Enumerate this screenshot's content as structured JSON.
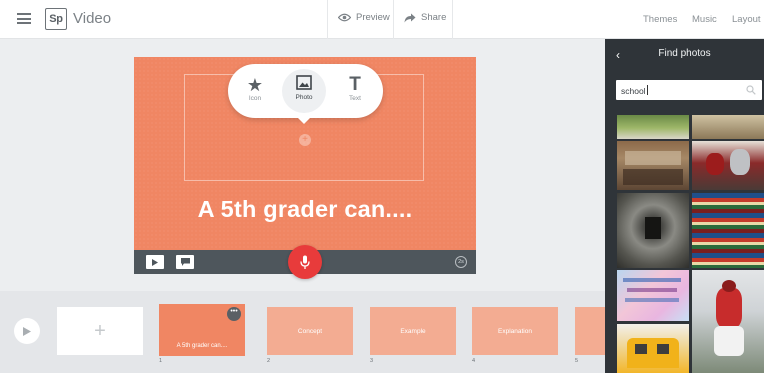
{
  "topbar": {
    "logo": "Sp",
    "app_name": "Video",
    "preview": "Preview",
    "share": "Share",
    "themes": "Themes",
    "music": "Music",
    "layout": "Layout"
  },
  "slide": {
    "title": "A 5th grader can....",
    "add_menu": {
      "icon": "Icon",
      "photo": "Photo",
      "text": "Text",
      "selected": "Photo"
    },
    "timer_badge": "2s"
  },
  "filmstrip": {
    "add_symbol": "+",
    "thumbs": [
      {
        "label": "A 5th grader can....",
        "number": "1",
        "active": true
      },
      {
        "label": "Concept",
        "number": "2"
      },
      {
        "label": "Example",
        "number": "3"
      },
      {
        "label": "Explanation",
        "number": "4"
      },
      {
        "label": "",
        "number": "5"
      }
    ]
  },
  "panel": {
    "title": "Find photos",
    "search_value": "school",
    "photo_results": [
      "field-photo",
      "sky-photo",
      "classroom-photo",
      "football-photo",
      "hallway-photo",
      "books-photo",
      "poster-photo",
      "baseball-photo",
      "bus-photo",
      "player-photo"
    ]
  },
  "colors": {
    "slide_bg": "#f08663",
    "mic": "#e83b3b",
    "panel": "#2f3439"
  }
}
